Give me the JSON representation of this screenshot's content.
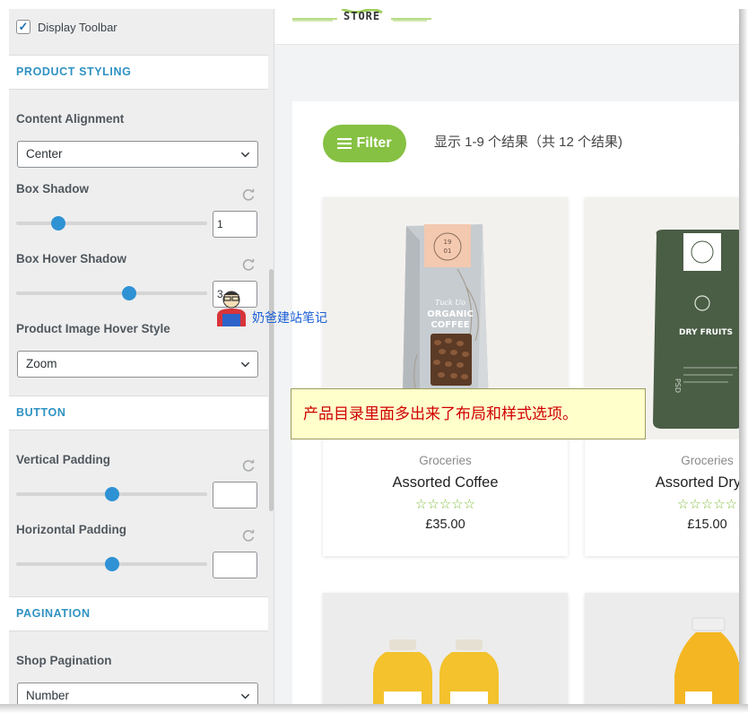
{
  "panel": {
    "display_toolbar": {
      "label": "Display Toolbar",
      "checked": true
    },
    "product_styling": {
      "heading": "PRODUCT STYLING",
      "content_alignment": {
        "label": "Content Alignment",
        "value": "Center"
      },
      "box_shadow": {
        "label": "Box Shadow",
        "value": "1",
        "level_fraction": 0.22
      },
      "box_hover_shadow": {
        "label": "Box Hover Shadow",
        "value": "3",
        "level_fraction": 0.59
      },
      "image_hover_style": {
        "label": "Product Image Hover Style",
        "value": "Zoom"
      }
    },
    "button": {
      "heading": "BUTTON",
      "vertical_padding": {
        "label": "Vertical Padding",
        "value": "",
        "level_fraction": 0.5
      },
      "horizontal_padding": {
        "label": "Horizontal Padding",
        "value": "",
        "level_fraction": 0.5
      }
    },
    "pagination": {
      "heading": "PAGINATION",
      "shop_pagination": {
        "label": "Shop Pagination",
        "value": "Number"
      }
    },
    "icons": {
      "reset": "reset-icon",
      "chevron": "chevron-down-icon",
      "check": "checkmark-icon"
    },
    "accent_color": "#2f92d4"
  },
  "store": {
    "logo_text": "STORE",
    "filter_label": "Filter",
    "result_count": "显示 1-9 个结果（共 12 个结果)",
    "accent_color": "#86c143",
    "products": [
      {
        "category": "Groceries",
        "title": "Assorted Coffee",
        "rating_stars": "☆☆☆☆☆",
        "price": "£35.00",
        "package": {
          "small_text": "Tuck Uo",
          "brand": "ORGANIC",
          "brand2": "COFFEE",
          "badge_top": "19",
          "badge_bottom": "01"
        }
      },
      {
        "category": "Groceries",
        "title": "Assorted Dry Fr",
        "rating_stars": "☆☆☆☆☆",
        "price": "£15.00",
        "package": {
          "brand": "DRY FRUITS",
          "side": "PSD"
        }
      }
    ]
  },
  "note": "产品目录里面多出来了布局和样式选项。",
  "watermark": "奶爸建站笔记"
}
